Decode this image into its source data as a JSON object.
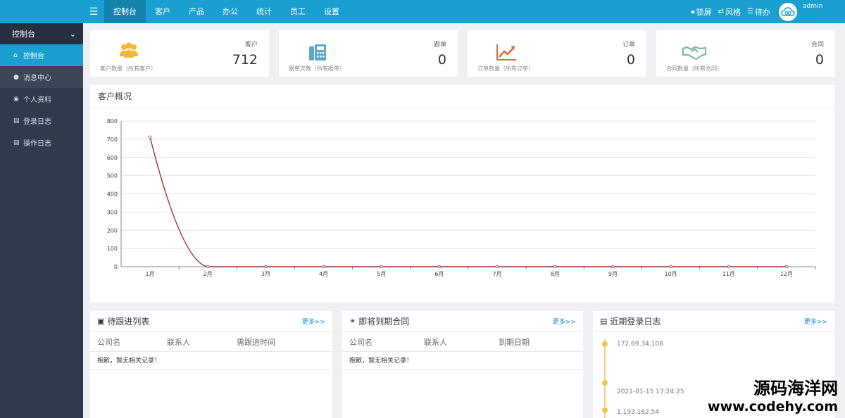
{
  "topbar": {
    "nav": [
      "控制台",
      "客户",
      "产品",
      "办公",
      "统计",
      "员工",
      "设置"
    ],
    "active_index": 0,
    "tools": [
      {
        "icon": "lock-icon",
        "label": "锁屏"
      },
      {
        "icon": "swap-icon",
        "label": "风格"
      },
      {
        "icon": "list-icon",
        "label": "待办"
      }
    ],
    "user": "admin",
    "accent": "#199fd0"
  },
  "sidebar": {
    "header": "控制台",
    "items": [
      {
        "icon": "home-icon",
        "label": "控制台",
        "active": true
      },
      {
        "icon": "comment-icon",
        "label": "消息中心"
      },
      {
        "icon": "user-icon",
        "label": "个人资料"
      },
      {
        "icon": "file-icon",
        "label": "登录日志"
      },
      {
        "icon": "file-icon",
        "label": "操作日志"
      }
    ]
  },
  "stats": [
    {
      "title": "客户",
      "value": "712",
      "sub": "客户数量（所有客户）",
      "icon": "users-icon",
      "color": "#f5b63a"
    },
    {
      "title": "跟单",
      "value": "0",
      "sub": "跟单次数（所有跟单）",
      "icon": "fax-icon",
      "color": "#5aa9c6"
    },
    {
      "title": "订单",
      "value": "0",
      "sub": "订单数量（所有订单）",
      "icon": "trend-icon",
      "color": "#e06b3f"
    },
    {
      "title": "合同",
      "value": "0",
      "sub": "合同数量（所有合同）",
      "icon": "handshake-icon",
      "color": "#78b89a"
    }
  ],
  "chart_panel_title": "客户概况",
  "chart_data": {
    "type": "line",
    "title": "",
    "categories": [
      "1月",
      "2月",
      "3月",
      "4月",
      "5月",
      "6月",
      "7月",
      "8月",
      "9月",
      "10月",
      "11月",
      "12月"
    ],
    "values": [
      712,
      0,
      0,
      0,
      0,
      0,
      0,
      0,
      0,
      0,
      0,
      0
    ],
    "ylim": [
      0,
      800
    ],
    "yticks": [
      0,
      100,
      200,
      300,
      400,
      500,
      600,
      700,
      800
    ],
    "grid": true,
    "line_color": "#a2302a"
  },
  "panels": [
    {
      "title": "待跟进列表",
      "icon": "briefcase-icon",
      "more": "更多>>",
      "columns": [
        "公司名",
        "联系人",
        "需跟进时间"
      ],
      "empty": "抱歉，暂无相关记录！"
    },
    {
      "title": "即将到期合同",
      "icon": "handshake-icon",
      "more": "更多>>",
      "columns": [
        "公司名",
        "联系人",
        "到期日期"
      ],
      "empty": "抱歉，暂无相关记录！"
    },
    {
      "title": "近期登录日志",
      "icon": "doc-icon",
      "more": "更多>>",
      "logs": [
        "172.69.34.108",
        "2021-01-15 17:24:25",
        "1.193.162.54"
      ]
    }
  ],
  "watermark": {
    "name": "源码海洋网",
    "url": "www.codehy.com"
  }
}
